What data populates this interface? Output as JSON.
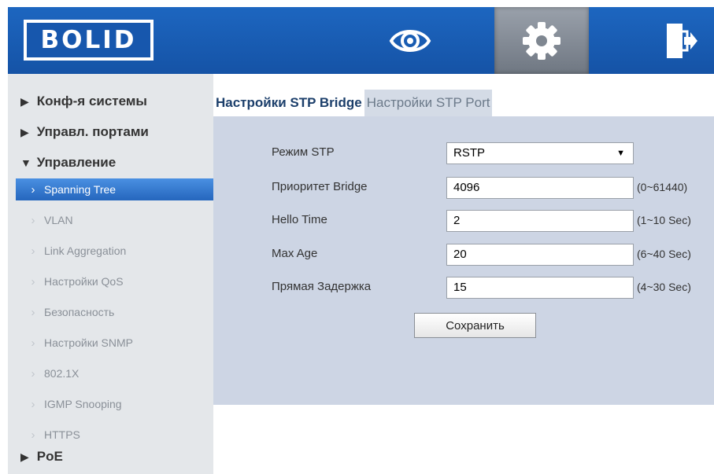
{
  "brand": {
    "logo_text": "BOLID",
    "accent": "#1a5fb4"
  },
  "toolbar": {
    "live_view_icon": "eye-icon",
    "settings_icon": "gear-icon",
    "logout_icon": "exit-door-icon"
  },
  "sidebar": {
    "groups": {
      "system": "Конф-я системы",
      "ports": "Управл. портами",
      "management": "Управление",
      "poe": "PoE"
    },
    "items": [
      {
        "label": "Spanning Tree",
        "active": true
      },
      {
        "label": "VLAN"
      },
      {
        "label": "Link Aggregation"
      },
      {
        "label": "Настройки QoS"
      },
      {
        "label": "Безопасность"
      },
      {
        "label": "Настройки SNMP"
      },
      {
        "label": "802.1X"
      },
      {
        "label": "IGMP Snooping"
      },
      {
        "label": "HTTPS"
      }
    ]
  },
  "tabs": {
    "bridge": "Настройки STP Bridge",
    "port": "Настройки STP Port"
  },
  "form": {
    "mode": {
      "label": "Режим STP",
      "value": "RSTP"
    },
    "priority": {
      "label": "Приоритет Bridge",
      "value": "4096",
      "range": "(0~61440)"
    },
    "hello": {
      "label": "Hello Time",
      "value": "2",
      "range": "(1~10 Sec)"
    },
    "max_age": {
      "label": "Max Age",
      "value": "20",
      "range": "(6~40 Sec)"
    },
    "forward_delay": {
      "label": "Прямая Задержка",
      "value": "15",
      "range": "(4~30 Sec)"
    },
    "save_label": "Сохранить"
  }
}
